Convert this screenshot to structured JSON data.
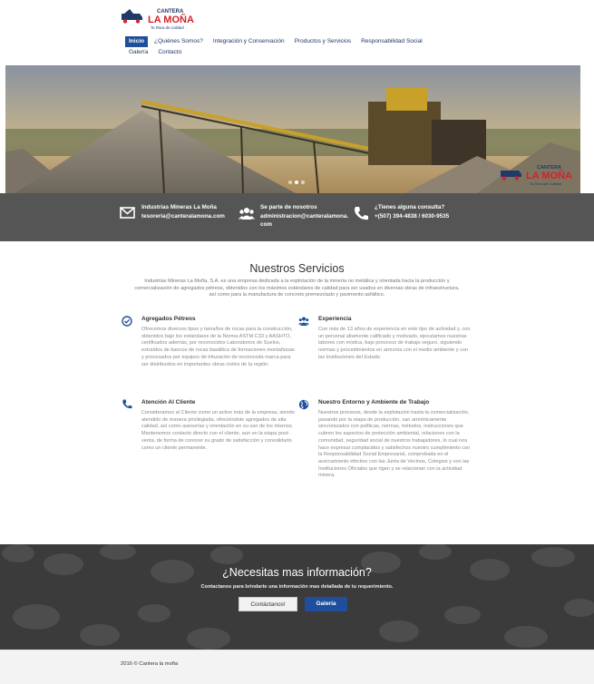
{
  "brand": {
    "logo_top": "CANTERA",
    "logo_name": "LA MOÑA",
    "logo_tagline": "Tu Roca de Calidad"
  },
  "nav": {
    "items": [
      {
        "label": "Inicio",
        "active": true
      },
      {
        "label": "¿Quiénes Somos?",
        "active": false
      },
      {
        "label": "Integración y Conservación",
        "active": false
      },
      {
        "label": "Productos y Servicios",
        "active": false
      },
      {
        "label": "Responsabilidad Social",
        "active": false
      },
      {
        "label": "Galería",
        "active": false
      },
      {
        "label": "Contacto",
        "active": false
      }
    ]
  },
  "hero": {
    "slide_count": 3,
    "active_slide": 2
  },
  "contact": {
    "email_title": "Industrias Mineras La Moña",
    "email_value": "tesoreria@canteralamona.com",
    "join_title": "Se parte de nosotros",
    "join_value": "administracion@canteralamona.com",
    "phone_title": "¿Tienes alguna consulta?",
    "phone_value": "+(507) 394-4838 / 6030-9535"
  },
  "services": {
    "title": "Nuestros Servicios",
    "intro": "Industrias Mineras La Moña, S.A. es una empresa dedicada a la explotación de la minería no metálica y orientada hacia la producción y comercialización de agregados pétreos, obtenidos con los máximos estándares de calidad para ser usados en diversas obras de infraestructura, así como para la manufactura de concreto premezclado y pavimento asfáltico.",
    "items": [
      {
        "title": "Agregados Pétreos",
        "icon": "check-circle-icon",
        "text": "Ofrecemos diversos tipos y tamaños de rocas para la construcción, obtenidos bajo los estándares de la Norma ASTM C33 y AASHTO, certificados además, por reconocidos Laboratorios de Suelos, extraídos de bancos de rocas basáltica de formaciones montañosas y procesados por equipos de trituración de reconocida marca para ser distribuidos en importantes obras civiles de la región."
      },
      {
        "title": "Experiencia",
        "icon": "users-icon",
        "text": "Con más de 13 años de experiencia en este tipo de actividad y, con un personal altamente calificado y motivado, ejecutamos nuestras labores con mística, bajo procesos de trabajo seguro, siguiendo normas y procedimientos en armonía con el medio ambiente y con las Instituciones del Estado."
      },
      {
        "title": "Atención Al Cliente",
        "icon": "phone-icon",
        "text": "Consideramos al Cliente como un activo más de la empresa, siendo atendido de manera privilegiada, ofreciéndole agregados de alta calidad, así como asesorías y orientación en su uso de los mismos. Mantenemos contacto directo con el cliente, aun en la etapa post-venta, de forma de conocer su grado de satisfacción y consolidarlo como un cliente permanente."
      },
      {
        "title": "Nuestro Entorno y Ambiente de Trabajo",
        "icon": "globe-icon",
        "text": "Nuestros procesos, desde la explotación hasta la comercialización, pasando por la etapa de producción, van armónicamente sincronizados con políticas, normas, métodos, instrucciones que cubren los aspectos de protección ambiental, relaciones con la comunidad, seguridad social de nuestros trabajadores, lo cual nos hace expresar complacidos y satisfechos nuestro cumplimiento con la Responsabilidad Social Empresarial, comprobada en el acercamiento efectivo con las Junta de Vecinos, Colegios y con las Instituciones Oficiales que rigen y se relacionan con la actividad minera."
      }
    ]
  },
  "cta": {
    "title": "¿Necesitas mas información?",
    "subtitle": "Contactanos para brindarte una información mas detallada de tu requerimiento.",
    "contact_button": "Contáctanos!",
    "gallery_button": "Galería"
  },
  "footer": {
    "copyright": "2016 © Cantera la moña"
  },
  "colors": {
    "primary": "#1f4f9c",
    "logo_red": "#d2232a",
    "band_gray": "#555555",
    "cta_bg": "#3a3a3a"
  }
}
